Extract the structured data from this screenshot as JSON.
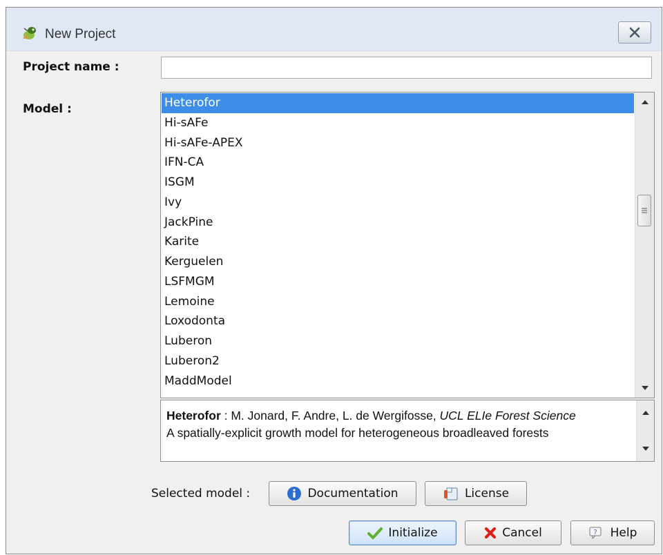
{
  "window": {
    "title": "New Project",
    "title_icon": "app-icon",
    "close_icon": "close-icon"
  },
  "form": {
    "project_name_label": "Project name :",
    "project_name_value": "",
    "model_label": "Model :"
  },
  "model_list": {
    "items": [
      "Heterofor",
      "Hi-sAFe",
      "Hi-sAFe-APEX",
      "IFN-CA",
      "ISGM",
      "Ivy",
      "JackPine",
      "Karite",
      "Kerguelen",
      "LSFMGM",
      "Lemoine",
      "Loxodonta",
      "Luberon",
      "Luberon2",
      "MaddModel"
    ],
    "selected_index": 0
  },
  "description": {
    "model_name": "Heterofor",
    "authors": " : M. Jonard, F. Andre, L. de Wergifosse, ",
    "affiliation": "UCL ELIe Forest Science",
    "summary": "A spatially-explicit growth model for heterogeneous broadleaved forests"
  },
  "selected_model": {
    "label": "Selected model :",
    "documentation_label": "Documentation",
    "license_label": "License"
  },
  "actions": {
    "initialize_label": "Initialize",
    "cancel_label": "Cancel",
    "help_label": "Help"
  },
  "colors": {
    "selection": "#3d8ee8",
    "titlebar": "#dfe8f4",
    "background": "#f0f0f0"
  }
}
